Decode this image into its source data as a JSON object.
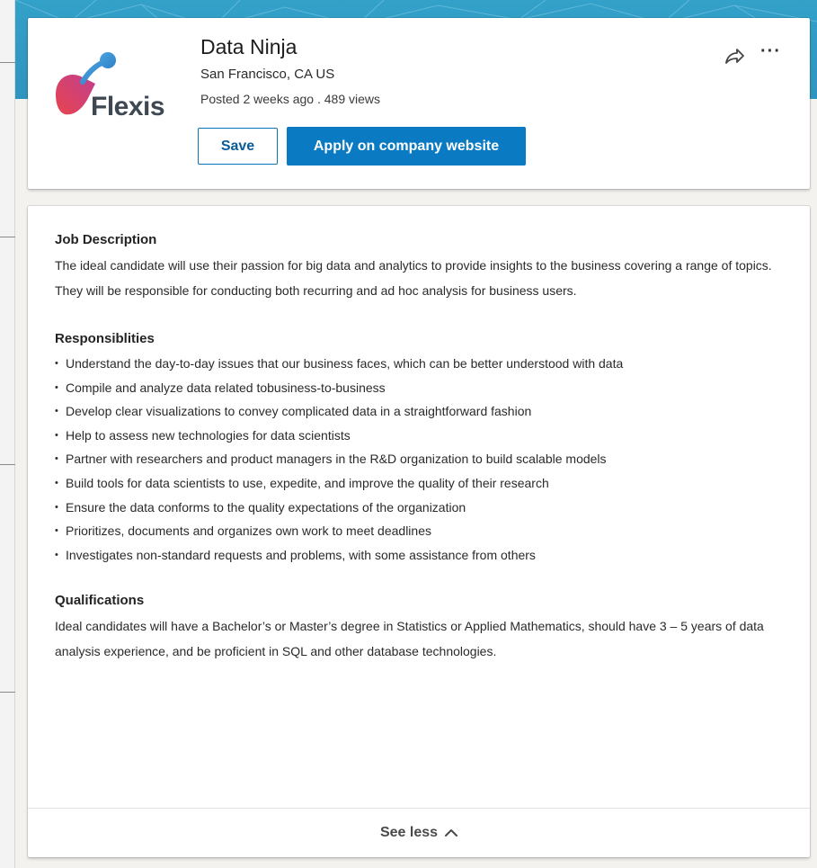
{
  "job": {
    "title": "Data Ninja",
    "location": "San Francisco, CA US",
    "posted": "Posted 2 weeks ago . 489 views"
  },
  "company": {
    "logo_text": "Flexis",
    "logo_icon": "flexis-logo-icon"
  },
  "actions": {
    "save_label": "Save",
    "apply_label": "Apply on company website",
    "share_icon": "share-icon",
    "more_label": "···"
  },
  "description": {
    "job_heading": "Job Description",
    "job_text": "The ideal candidate will use their passion for big data and analytics to provide insights to the business covering a range of topics. They will be responsible for conducting both recurring and ad hoc analysis for business users.",
    "resp_heading": "Responsiblities",
    "responsibilities": [
      "Understand the day-to-day issues that our business faces, which can be better understood with data",
      "Compile and analyze data related tobusiness-to-business",
      "Develop clear visualizations to convey complicated data in a straightforward fashion",
      "Help to assess new technologies for data scientists",
      "Partner with researchers and product managers in the R&D organization to build scalable models",
      "Build tools for data scientists to use, expedite, and improve the quality of their research",
      "Ensure the data conforms to the quality expectations of the organization",
      "Prioritizes, documents and organizes own work to meet deadlines",
      "Investigates non-standard requests and problems, with some assistance from others"
    ],
    "qual_heading": "Qualifications",
    "qual_text": "Ideal candidates will have a Bachelor’s or Master’s degree in Statistics or Applied Mathematics, should have 3 – 5 years of data analysis experience, and be proficient in SQL and other database technologies."
  },
  "footer": {
    "see_less_label": "See less",
    "chevron_icon": "chevron-up-icon"
  },
  "colors": {
    "primary": "#0a7bc2",
    "banner": "#33a1c9",
    "background": "#f3f2ef"
  }
}
